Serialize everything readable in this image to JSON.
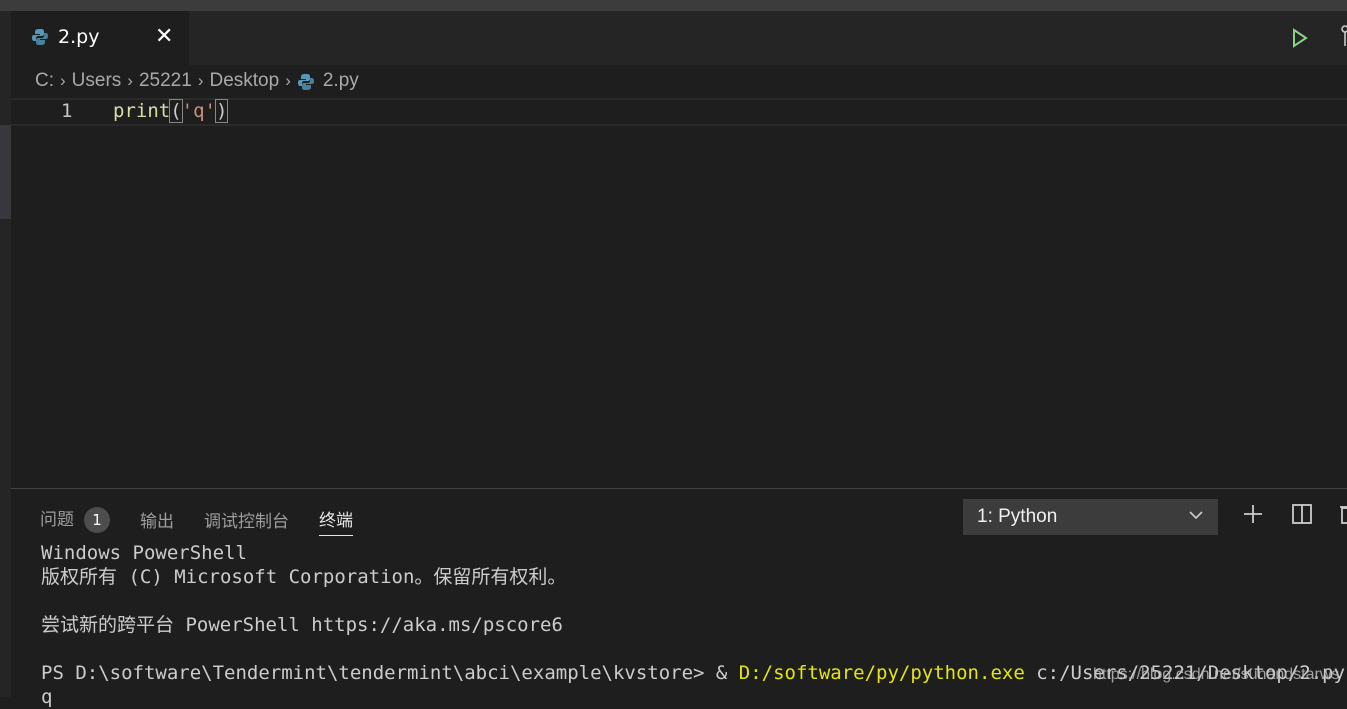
{
  "tab": {
    "filename": "2.py"
  },
  "breadcrumb": [
    "C:",
    "Users",
    "25221",
    "Desktop",
    "2.py"
  ],
  "editor": {
    "line_number": "1",
    "code": {
      "fn": "print",
      "open": "(",
      "str": "'q'",
      "close": ")"
    }
  },
  "panel": {
    "tabs": [
      {
        "label": "问题",
        "badge": "1"
      },
      {
        "label": "输出"
      },
      {
        "label": "调试控制台"
      },
      {
        "label": "终端",
        "active": true
      }
    ],
    "terminal_select": "1: Python"
  },
  "terminal": {
    "line1": "Windows PowerShell",
    "line2": "版权所有 (C) Microsoft Corporation。保留所有权利。",
    "line3": "尝试新的跨平台 PowerShell https://aka.ms/pscore6",
    "prompt": "PS D:\\software\\Tendermint\\tendermint\\abci\\example\\kvstore> & ",
    "exe": "D:/software/py/python.exe",
    "arg": " c:/Users/25221/Desktop/2.py",
    "output": "q"
  },
  "watermark": "https://blog.csdn.net/sunandstarws",
  "colors": {
    "accent_run": "#89d185",
    "python_icon": "#519aba",
    "terminal_yellow": "#e5e510"
  }
}
